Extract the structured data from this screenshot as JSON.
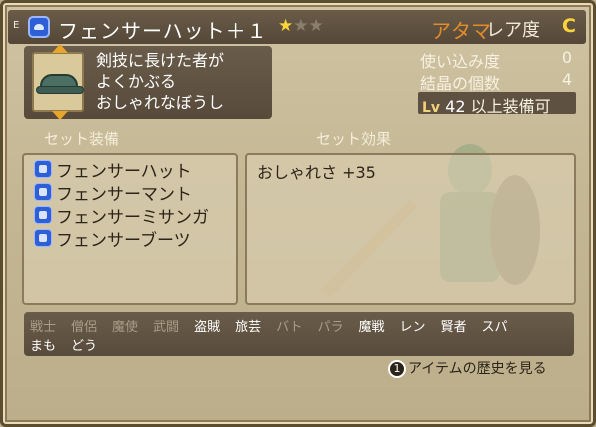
{
  "header": {
    "e_mark": "E",
    "item_icon": "hat-icon",
    "item_name": "フェンサーハット＋１",
    "stars": {
      "filled": 1,
      "total": 3
    },
    "slot": "アタマ",
    "rarity_label": "レア度",
    "rarity_value": "C"
  },
  "description": {
    "lines": [
      "剣技に長けた者が",
      "よくかぶる",
      "おしゃれなぼうし"
    ]
  },
  "stats": {
    "usage_label": "使い込み度",
    "usage_value": "0",
    "crystal_label": "結晶の個数",
    "crystal_value": "4",
    "level_prefix": "Lv",
    "level_value": "42",
    "level_suffix": "以上装備可"
  },
  "sections": {
    "set_equipment": "セット装備",
    "set_effect": "セット効果"
  },
  "set_items": [
    {
      "label": "フェンサーハット",
      "icon": "hat-icon"
    },
    {
      "label": "フェンサーマント",
      "icon": "armor-icon"
    },
    {
      "label": "フェンサーミサンガ",
      "icon": "glove-icon"
    },
    {
      "label": "フェンサーブーツ",
      "icon": "boots-icon"
    }
  ],
  "set_effect_text": "おしゃれさ +35",
  "jobs": {
    "row1": [
      {
        "label": "戦士",
        "enabled": false
      },
      {
        "label": "僧侶",
        "enabled": false
      },
      {
        "label": "魔使",
        "enabled": false
      },
      {
        "label": "武闘",
        "enabled": false
      },
      {
        "label": "盗賊",
        "enabled": true
      },
      {
        "label": "旅芸",
        "enabled": true
      },
      {
        "label": "バト",
        "enabled": false
      },
      {
        "label": "パラ",
        "enabled": false
      },
      {
        "label": "魔戦",
        "enabled": true
      },
      {
        "label": "レン",
        "enabled": true
      },
      {
        "label": "賢者",
        "enabled": true
      },
      {
        "label": "スパ",
        "enabled": true
      }
    ],
    "row2": [
      {
        "label": "まも",
        "enabled": true
      },
      {
        "label": "どう",
        "enabled": true
      }
    ]
  },
  "footer": {
    "button_glyph": "1",
    "history_label": "アイテムの歴史を見る"
  },
  "colors": {
    "slot": "#e38c2c",
    "rarity": "#ffd33a",
    "panel_dark": "#584b3b",
    "job_enabled": "#ffffff",
    "job_disabled": "#a99d86"
  }
}
